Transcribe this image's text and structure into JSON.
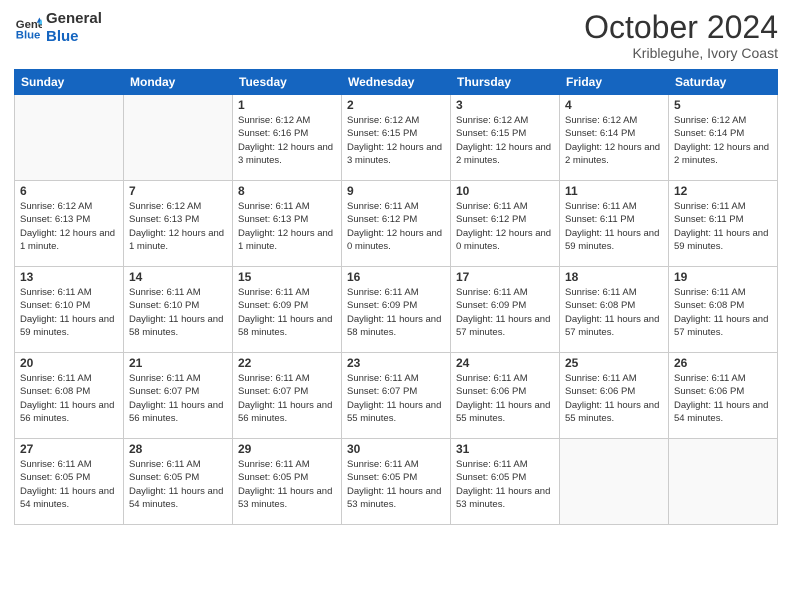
{
  "logo": {
    "line1": "General",
    "line2": "Blue"
  },
  "header": {
    "month": "October 2024",
    "location": "Kribleguhe, Ivory Coast"
  },
  "weekdays": [
    "Sunday",
    "Monday",
    "Tuesday",
    "Wednesday",
    "Thursday",
    "Friday",
    "Saturday"
  ],
  "weeks": [
    [
      {
        "day": "",
        "sunrise": "",
        "sunset": "",
        "daylight": ""
      },
      {
        "day": "",
        "sunrise": "",
        "sunset": "",
        "daylight": ""
      },
      {
        "day": "1",
        "sunrise": "Sunrise: 6:12 AM",
        "sunset": "Sunset: 6:16 PM",
        "daylight": "Daylight: 12 hours and 3 minutes."
      },
      {
        "day": "2",
        "sunrise": "Sunrise: 6:12 AM",
        "sunset": "Sunset: 6:15 PM",
        "daylight": "Daylight: 12 hours and 3 minutes."
      },
      {
        "day": "3",
        "sunrise": "Sunrise: 6:12 AM",
        "sunset": "Sunset: 6:15 PM",
        "daylight": "Daylight: 12 hours and 2 minutes."
      },
      {
        "day": "4",
        "sunrise": "Sunrise: 6:12 AM",
        "sunset": "Sunset: 6:14 PM",
        "daylight": "Daylight: 12 hours and 2 minutes."
      },
      {
        "day": "5",
        "sunrise": "Sunrise: 6:12 AM",
        "sunset": "Sunset: 6:14 PM",
        "daylight": "Daylight: 12 hours and 2 minutes."
      }
    ],
    [
      {
        "day": "6",
        "sunrise": "Sunrise: 6:12 AM",
        "sunset": "Sunset: 6:13 PM",
        "daylight": "Daylight: 12 hours and 1 minute."
      },
      {
        "day": "7",
        "sunrise": "Sunrise: 6:12 AM",
        "sunset": "Sunset: 6:13 PM",
        "daylight": "Daylight: 12 hours and 1 minute."
      },
      {
        "day": "8",
        "sunrise": "Sunrise: 6:11 AM",
        "sunset": "Sunset: 6:13 PM",
        "daylight": "Daylight: 12 hours and 1 minute."
      },
      {
        "day": "9",
        "sunrise": "Sunrise: 6:11 AM",
        "sunset": "Sunset: 6:12 PM",
        "daylight": "Daylight: 12 hours and 0 minutes."
      },
      {
        "day": "10",
        "sunrise": "Sunrise: 6:11 AM",
        "sunset": "Sunset: 6:12 PM",
        "daylight": "Daylight: 12 hours and 0 minutes."
      },
      {
        "day": "11",
        "sunrise": "Sunrise: 6:11 AM",
        "sunset": "Sunset: 6:11 PM",
        "daylight": "Daylight: 11 hours and 59 minutes."
      },
      {
        "day": "12",
        "sunrise": "Sunrise: 6:11 AM",
        "sunset": "Sunset: 6:11 PM",
        "daylight": "Daylight: 11 hours and 59 minutes."
      }
    ],
    [
      {
        "day": "13",
        "sunrise": "Sunrise: 6:11 AM",
        "sunset": "Sunset: 6:10 PM",
        "daylight": "Daylight: 11 hours and 59 minutes."
      },
      {
        "day": "14",
        "sunrise": "Sunrise: 6:11 AM",
        "sunset": "Sunset: 6:10 PM",
        "daylight": "Daylight: 11 hours and 58 minutes."
      },
      {
        "day": "15",
        "sunrise": "Sunrise: 6:11 AM",
        "sunset": "Sunset: 6:09 PM",
        "daylight": "Daylight: 11 hours and 58 minutes."
      },
      {
        "day": "16",
        "sunrise": "Sunrise: 6:11 AM",
        "sunset": "Sunset: 6:09 PM",
        "daylight": "Daylight: 11 hours and 58 minutes."
      },
      {
        "day": "17",
        "sunrise": "Sunrise: 6:11 AM",
        "sunset": "Sunset: 6:09 PM",
        "daylight": "Daylight: 11 hours and 57 minutes."
      },
      {
        "day": "18",
        "sunrise": "Sunrise: 6:11 AM",
        "sunset": "Sunset: 6:08 PM",
        "daylight": "Daylight: 11 hours and 57 minutes."
      },
      {
        "day": "19",
        "sunrise": "Sunrise: 6:11 AM",
        "sunset": "Sunset: 6:08 PM",
        "daylight": "Daylight: 11 hours and 57 minutes."
      }
    ],
    [
      {
        "day": "20",
        "sunrise": "Sunrise: 6:11 AM",
        "sunset": "Sunset: 6:08 PM",
        "daylight": "Daylight: 11 hours and 56 minutes."
      },
      {
        "day": "21",
        "sunrise": "Sunrise: 6:11 AM",
        "sunset": "Sunset: 6:07 PM",
        "daylight": "Daylight: 11 hours and 56 minutes."
      },
      {
        "day": "22",
        "sunrise": "Sunrise: 6:11 AM",
        "sunset": "Sunset: 6:07 PM",
        "daylight": "Daylight: 11 hours and 56 minutes."
      },
      {
        "day": "23",
        "sunrise": "Sunrise: 6:11 AM",
        "sunset": "Sunset: 6:07 PM",
        "daylight": "Daylight: 11 hours and 55 minutes."
      },
      {
        "day": "24",
        "sunrise": "Sunrise: 6:11 AM",
        "sunset": "Sunset: 6:06 PM",
        "daylight": "Daylight: 11 hours and 55 minutes."
      },
      {
        "day": "25",
        "sunrise": "Sunrise: 6:11 AM",
        "sunset": "Sunset: 6:06 PM",
        "daylight": "Daylight: 11 hours and 55 minutes."
      },
      {
        "day": "26",
        "sunrise": "Sunrise: 6:11 AM",
        "sunset": "Sunset: 6:06 PM",
        "daylight": "Daylight: 11 hours and 54 minutes."
      }
    ],
    [
      {
        "day": "27",
        "sunrise": "Sunrise: 6:11 AM",
        "sunset": "Sunset: 6:05 PM",
        "daylight": "Daylight: 11 hours and 54 minutes."
      },
      {
        "day": "28",
        "sunrise": "Sunrise: 6:11 AM",
        "sunset": "Sunset: 6:05 PM",
        "daylight": "Daylight: 11 hours and 54 minutes."
      },
      {
        "day": "29",
        "sunrise": "Sunrise: 6:11 AM",
        "sunset": "Sunset: 6:05 PM",
        "daylight": "Daylight: 11 hours and 53 minutes."
      },
      {
        "day": "30",
        "sunrise": "Sunrise: 6:11 AM",
        "sunset": "Sunset: 6:05 PM",
        "daylight": "Daylight: 11 hours and 53 minutes."
      },
      {
        "day": "31",
        "sunrise": "Sunrise: 6:11 AM",
        "sunset": "Sunset: 6:05 PM",
        "daylight": "Daylight: 11 hours and 53 minutes."
      },
      {
        "day": "",
        "sunrise": "",
        "sunset": "",
        "daylight": ""
      },
      {
        "day": "",
        "sunrise": "",
        "sunset": "",
        "daylight": ""
      }
    ]
  ]
}
